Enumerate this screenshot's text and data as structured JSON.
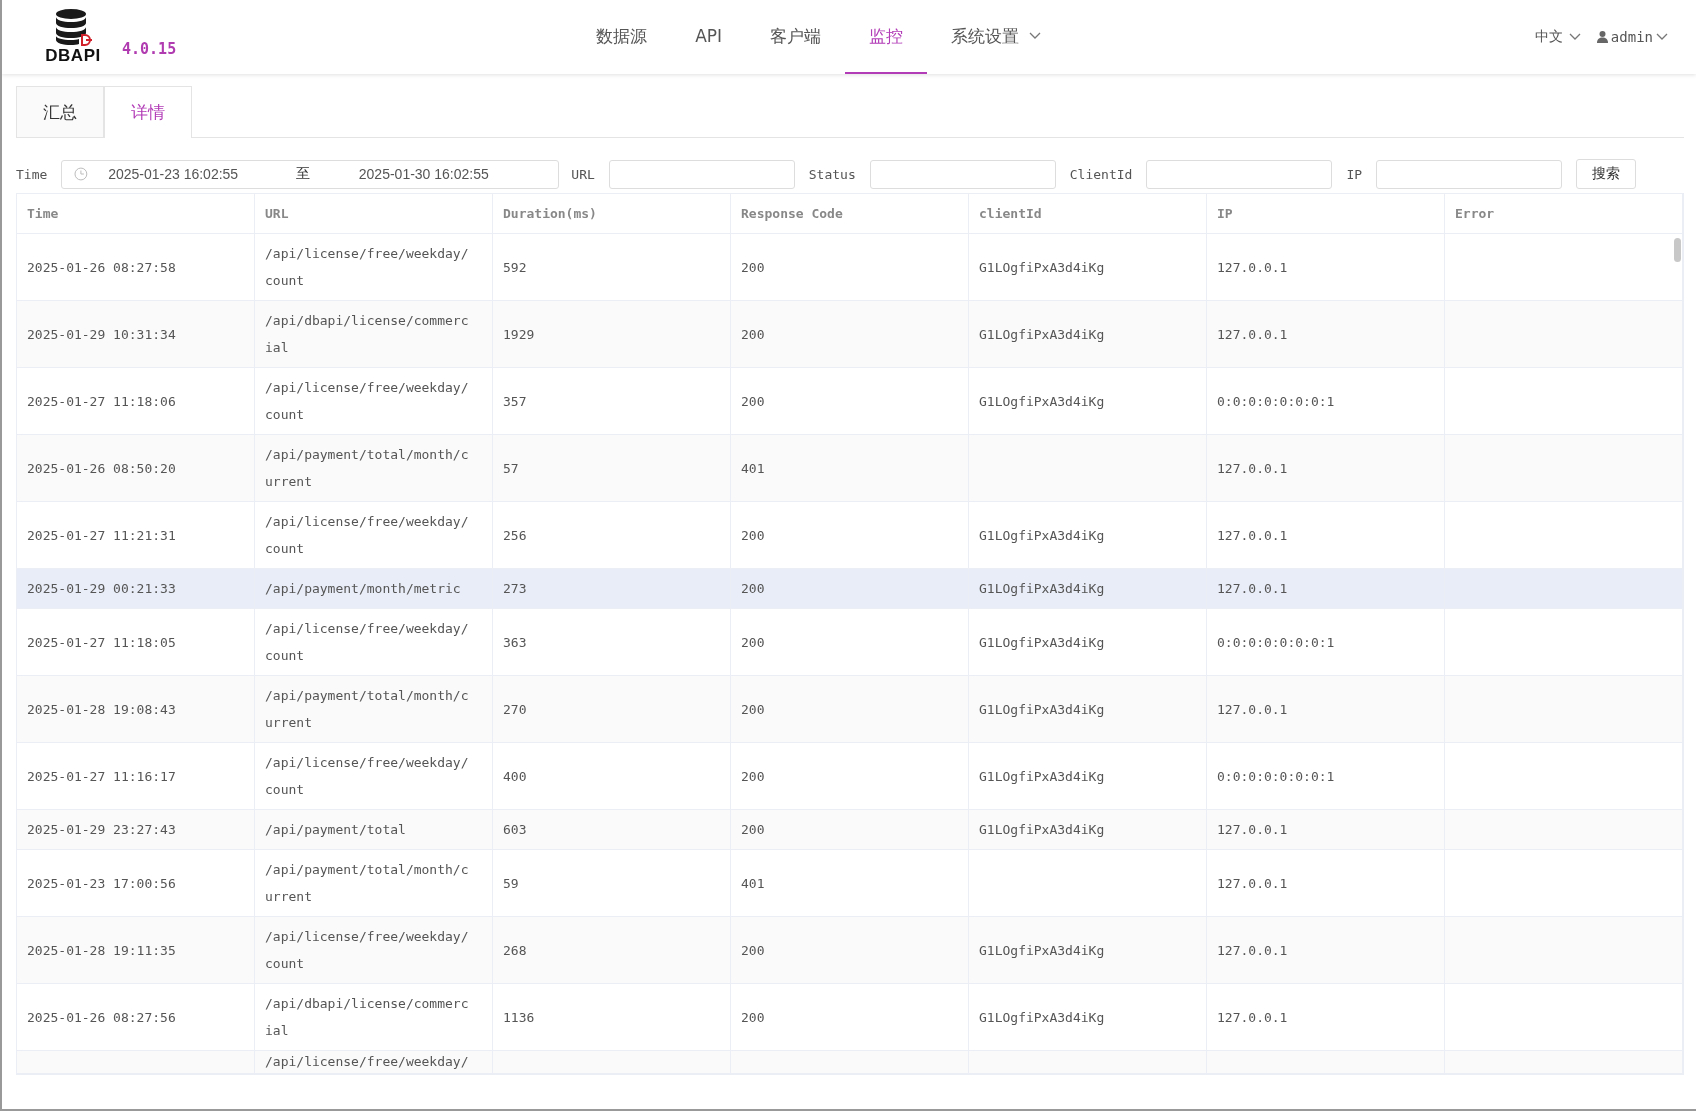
{
  "header": {
    "logo_text": "DBAPI",
    "version": "4.0.15",
    "nav": [
      {
        "label": "数据源",
        "selected": false,
        "dropdown": false
      },
      {
        "label": "API",
        "selected": false,
        "dropdown": false
      },
      {
        "label": "客户端",
        "selected": false,
        "dropdown": false
      },
      {
        "label": "监控",
        "selected": true,
        "dropdown": false
      },
      {
        "label": "系统设置",
        "selected": false,
        "dropdown": true
      }
    ],
    "language": "中文",
    "user": "admin"
  },
  "tabs": [
    {
      "label": "汇总",
      "selected": false
    },
    {
      "label": "详情",
      "selected": true
    }
  ],
  "filters": {
    "time_label": "Time",
    "start": "2025-01-23 16:02:55",
    "separator": "至",
    "end": "2025-01-30 16:02:55",
    "fields": [
      {
        "label": "URL"
      },
      {
        "label": "Status"
      },
      {
        "label": "ClientId"
      },
      {
        "label": "IP"
      }
    ],
    "search_button": "搜索"
  },
  "table": {
    "columns": [
      "Time",
      "URL",
      "Duration(ms)",
      "Response Code",
      "clientId",
      "IP",
      "Error"
    ],
    "rows": [
      {
        "time": "2025-01-26 08:27:58",
        "url": "/api/license/free/weekday/count",
        "duration": "592",
        "code": "200",
        "client": "G1LOgfiPxA3d4iKg",
        "ip": "127.0.0.1",
        "highlighted": false
      },
      {
        "time": "2025-01-29 10:31:34",
        "url": "/api/dbapi/license/commercial",
        "duration": "1929",
        "code": "200",
        "client": "G1LOgfiPxA3d4iKg",
        "ip": "127.0.0.1",
        "highlighted": false
      },
      {
        "time": "2025-01-27 11:18:06",
        "url": "/api/license/free/weekday/count",
        "duration": "357",
        "code": "200",
        "client": "G1LOgfiPxA3d4iKg",
        "ip": "0:0:0:0:0:0:0:1",
        "highlighted": false
      },
      {
        "time": "2025-01-26 08:50:20",
        "url": "/api/payment/total/month/current",
        "duration": "57",
        "code": "401",
        "client": "",
        "ip": "127.0.0.1",
        "highlighted": false
      },
      {
        "time": "2025-01-27 11:21:31",
        "url": "/api/license/free/weekday/count",
        "duration": "256",
        "code": "200",
        "client": "G1LOgfiPxA3d4iKg",
        "ip": "127.0.0.1",
        "highlighted": false
      },
      {
        "time": "2025-01-29 00:21:33",
        "url": "/api/payment/month/metric",
        "duration": "273",
        "code": "200",
        "client": "G1LOgfiPxA3d4iKg",
        "ip": "127.0.0.1",
        "highlighted": true
      },
      {
        "time": "2025-01-27 11:18:05",
        "url": "/api/license/free/weekday/count",
        "duration": "363",
        "code": "200",
        "client": "G1LOgfiPxA3d4iKg",
        "ip": "0:0:0:0:0:0:0:1",
        "highlighted": false
      },
      {
        "time": "2025-01-28 19:08:43",
        "url": "/api/payment/total/month/current",
        "duration": "270",
        "code": "200",
        "client": "G1LOgfiPxA3d4iKg",
        "ip": "127.0.0.1",
        "highlighted": false
      },
      {
        "time": "2025-01-27 11:16:17",
        "url": "/api/license/free/weekday/count",
        "duration": "400",
        "code": "200",
        "client": "G1LOgfiPxA3d4iKg",
        "ip": "0:0:0:0:0:0:0:1",
        "highlighted": false
      },
      {
        "time": "2025-01-29 23:27:43",
        "url": "/api/payment/total",
        "duration": "603",
        "code": "200",
        "client": "G1LOgfiPxA3d4iKg",
        "ip": "127.0.0.1",
        "highlighted": false
      },
      {
        "time": "2025-01-23 17:00:56",
        "url": "/api/payment/total/month/current",
        "duration": "59",
        "code": "401",
        "client": "",
        "ip": "127.0.0.1",
        "highlighted": false
      },
      {
        "time": "2025-01-28 19:11:35",
        "url": "/api/license/free/weekday/count",
        "duration": "268",
        "code": "200",
        "client": "G1LOgfiPxA3d4iKg",
        "ip": "127.0.0.1",
        "highlighted": false
      },
      {
        "time": "2025-01-26 08:27:56",
        "url": "/api/dbapi/license/commercial",
        "duration": "1136",
        "code": "200",
        "client": "G1LOgfiPxA3d4iKg",
        "ip": "127.0.0.1",
        "highlighted": false
      },
      {
        "time": "",
        "url": "/api/license/free/weekday/",
        "duration": "",
        "code": "",
        "client": "",
        "ip": "",
        "highlighted": false
      }
    ]
  }
}
